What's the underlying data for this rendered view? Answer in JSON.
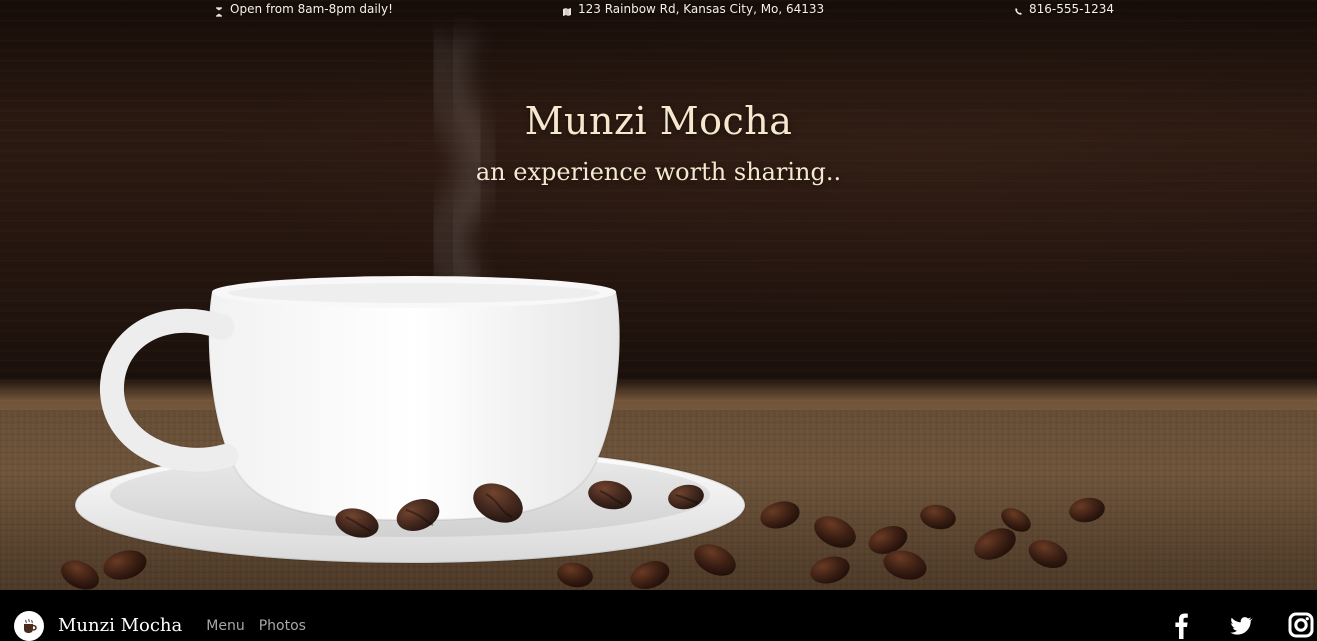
{
  "colors": {
    "topbar_text": "#f7f0e6",
    "hero_title": "#f6e7cf",
    "footer_bg": "#000000",
    "footer_link": "#a8a8a8",
    "footer_text": "#ffffff"
  },
  "topbar": {
    "hours": {
      "icon": "hourglass-icon",
      "text": "Open from 8am-8pm daily!"
    },
    "address": {
      "icon": "map-icon",
      "text": "123 Rainbow Rd, Kansas City, Mo, 64133"
    },
    "phone": {
      "icon": "phone-icon",
      "text": "816-555-1234"
    }
  },
  "hero": {
    "title": "Munzi Mocha",
    "tagline": "an experience worth sharing.."
  },
  "footer": {
    "brand": "Munzi Mocha",
    "nav": [
      "Menu",
      "Photos"
    ],
    "social": [
      {
        "name": "facebook-icon"
      },
      {
        "name": "twitter-icon"
      },
      {
        "name": "instagram-icon"
      }
    ]
  }
}
